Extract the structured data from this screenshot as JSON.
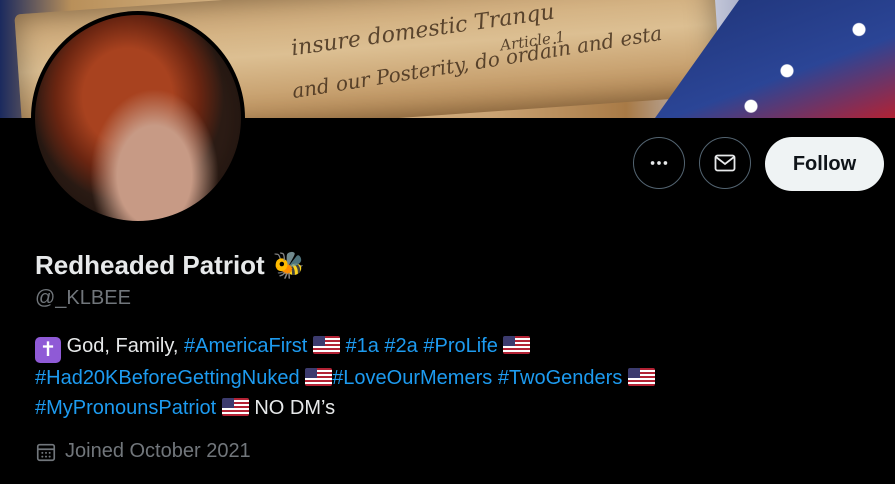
{
  "banner": {
    "script_lines": [
      "insure domestic Tranqu",
      "and our Posterity, do ordain and esta",
      "Article 1"
    ]
  },
  "profile": {
    "name": "Redheaded Patriot",
    "name_emoji": "🐝",
    "handle": "@_KLBEE",
    "joined": "Joined October 2021"
  },
  "actions": {
    "more_icon": "more-horizontal-icon",
    "message_icon": "envelope-icon",
    "follow_label": "Follow"
  },
  "bio": {
    "cross": "✝",
    "line1_text": "God, Family, ",
    "line1_tags": [
      "#AmericaFirst",
      "#1a",
      "#2a",
      "#ProLife"
    ],
    "line2_tags": [
      "#Had20KBeforeGettingNuked",
      "#LoveOurMemers",
      "#TwoGenders"
    ],
    "line3_tag": "#MyPronounsPatriot",
    "line3_text": "NO DM’s"
  },
  "colors": {
    "link": "#1d9bf0",
    "muted": "#71767b",
    "text": "#e7e9ea",
    "background": "#000000"
  }
}
